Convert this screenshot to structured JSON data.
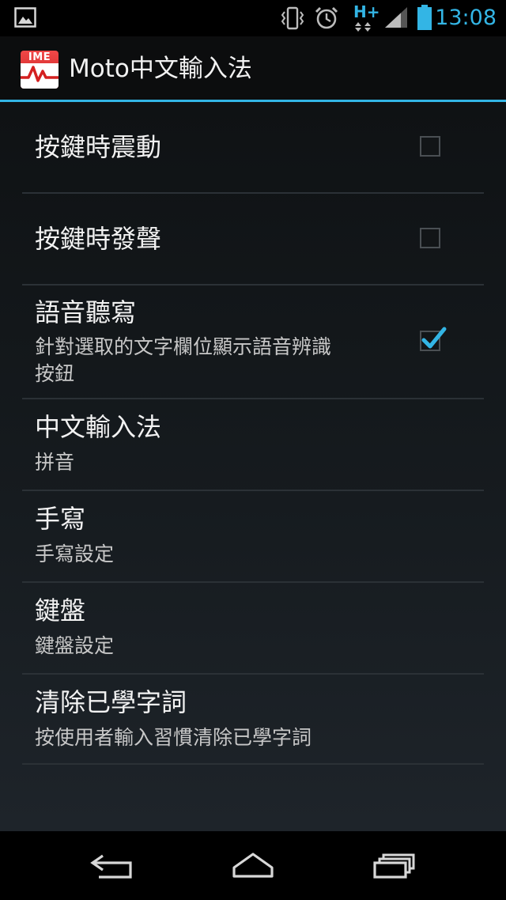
{
  "status_bar": {
    "time": "13:08",
    "network_label": "H+",
    "accent_color": "#33b5e5",
    "icons": [
      "gallery-notification-icon",
      "vibrate-icon",
      "alarm-icon",
      "network-activity-icon",
      "signal-icon",
      "battery-icon"
    ]
  },
  "action_bar": {
    "icon_label": "IME",
    "title": "Moto中文輸入法"
  },
  "settings": {
    "items": [
      {
        "title": "按鍵時震動",
        "checked": false
      },
      {
        "title": "按鍵時發聲",
        "checked": false
      },
      {
        "title": "語音聽寫",
        "summary_line1": "針對選取的文字欄位顯示語音辨識",
        "summary_line2": "按鈕",
        "checked": true
      },
      {
        "title": "中文輸入法",
        "summary": "拼音"
      },
      {
        "title": "手寫",
        "summary": "手寫設定"
      },
      {
        "title": "鍵盤",
        "summary": "鍵盤設定"
      },
      {
        "title": "清除已學字詞",
        "summary": "按使用者輸入習慣清除已學字詞"
      }
    ]
  },
  "nav_bar": {
    "buttons": [
      "back-icon",
      "home-icon",
      "recent-apps-icon"
    ]
  }
}
